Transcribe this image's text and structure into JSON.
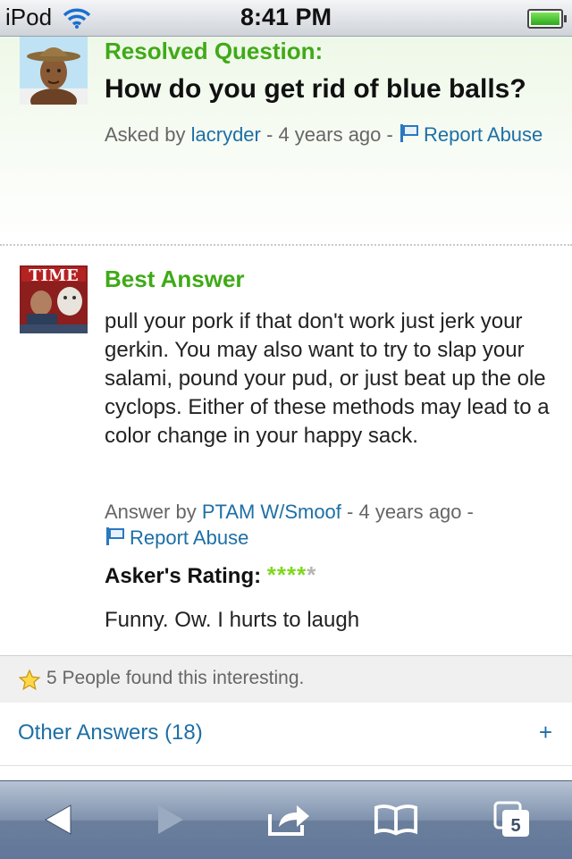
{
  "status_bar": {
    "device": "iPod",
    "time": "8:41 PM"
  },
  "question": {
    "label": "Resolved Question:",
    "title": "How do you get rid of blue balls?",
    "asked_prefix": "Asked by",
    "asker": "lacryder",
    "age": "- 4 years ago -",
    "report": "Report Abuse"
  },
  "answer": {
    "label": "Best Answer",
    "body": "pull your pork if that don't work just jerk your gerkin. You may also want to try to slap your salami, pound your pud, or just beat up the ole cyclops. Either of these methods may lead to a color change in your happy sack.",
    "answer_prefix": "Answer by",
    "author": "PTAM W/Smoof",
    "age": "- 4 years ago -",
    "report": "Report Abuse",
    "rating_label": "Asker's Rating:",
    "rating": 4,
    "rating_max": 5,
    "comment": "Funny. Ow. I hurts to laugh"
  },
  "interest": {
    "text": "5 People found this interesting."
  },
  "other_answers": {
    "label": "Other Answers (18)",
    "expand": "+"
  },
  "toolbar": {
    "tabs_count": "5"
  },
  "colors": {
    "accent_green": "#3faa17",
    "link_blue": "#1d6fa6"
  }
}
